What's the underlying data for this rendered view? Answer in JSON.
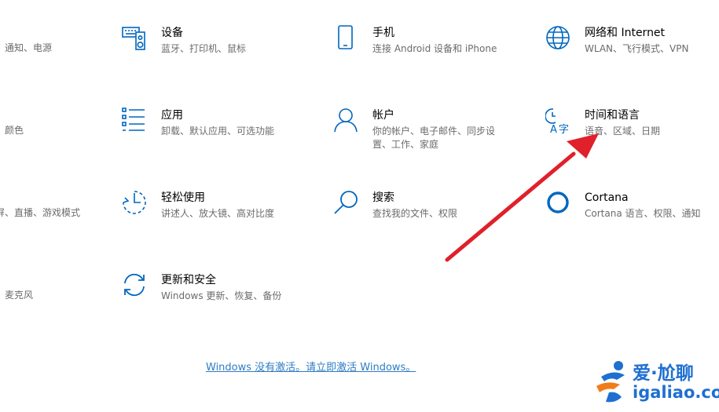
{
  "left_partial": [
    "通知、电源",
    "颜色",
    "屏、直播、游戏模式",
    "麦克风"
  ],
  "tiles": [
    {
      "title": "设备",
      "desc": "蓝牙、打印机、鼠标",
      "icon": "keyboard-speaker-icon"
    },
    {
      "title": "手机",
      "desc": "连接 Android 设备和 iPhone",
      "icon": "phone-icon"
    },
    {
      "title": "网络和 Internet",
      "desc": "WLAN、飞行模式、VPN",
      "icon": "globe-icon"
    },
    {
      "title": "应用",
      "desc": "卸载、默认应用、可选功能",
      "icon": "apps-list-icon"
    },
    {
      "title": "帐户",
      "desc": "你的帐户、电子邮件、同步设置、工作、家庭",
      "icon": "person-icon"
    },
    {
      "title": "时间和语言",
      "desc": "语音、区域、日期",
      "icon": "time-language-icon"
    },
    {
      "title": "轻松使用",
      "desc": "讲述人、放大镜、高对比度",
      "icon": "ease-of-access-icon"
    },
    {
      "title": "搜索",
      "desc": "查找我的文件、权限",
      "icon": "search-icon"
    },
    {
      "title": "Cortana",
      "desc": "Cortana 语言、权限、通知",
      "icon": "cortana-circle-icon"
    },
    {
      "title": "更新和安全",
      "desc": "Windows 更新、恢复、备份",
      "icon": "update-sync-icon"
    }
  ],
  "activation_link": "Windows 没有激活。请立即激活 Windows。",
  "watermark": {
    "line1": "爱·尬聊",
    "line2": "igaliao.com"
  },
  "colors": {
    "accent": "#0067c0",
    "link": "#2f7cc4",
    "arrow": "#e0202a",
    "watermark": "#1f6fd1"
  }
}
